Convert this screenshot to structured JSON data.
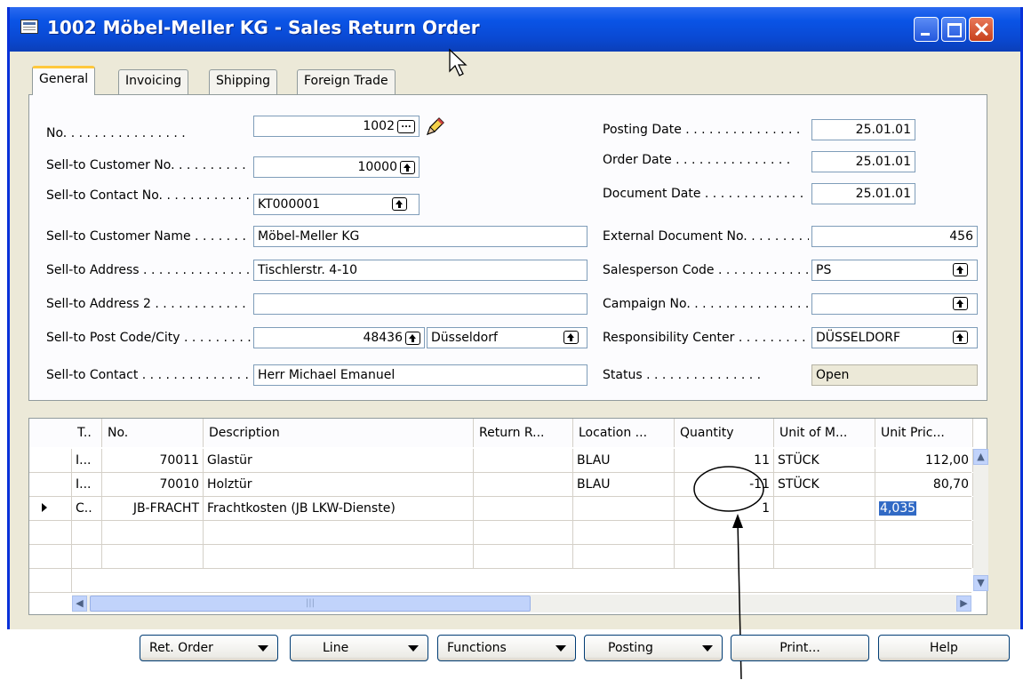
{
  "window": {
    "title": "1002 Möbel-Meller KG - Sales Return Order"
  },
  "tabs": [
    "General",
    "Invoicing",
    "Shipping",
    "Foreign Trade"
  ],
  "general": {
    "no": {
      "label": "No.",
      "value": "1002"
    },
    "sell_to_customer_no": {
      "label": "Sell-to Customer No.",
      "value": "10000"
    },
    "sell_to_contact_no": {
      "label": "Sell-to Contact No.",
      "value": "KT000001"
    },
    "sell_to_customer_name": {
      "label": "Sell-to Customer Name",
      "value": "Möbel-Meller KG"
    },
    "sell_to_address": {
      "label": "Sell-to Address",
      "value": "Tischlerstr. 4-10"
    },
    "sell_to_address_2": {
      "label": "Sell-to Address 2",
      "value": ""
    },
    "sell_to_post_code_city": {
      "label": "Sell-to Post Code/City",
      "post_code": "48436",
      "city": "Düsseldorf"
    },
    "sell_to_contact": {
      "label": "Sell-to Contact",
      "value": "Herr Michael Emanuel"
    },
    "posting_date": {
      "label": "Posting Date",
      "value": "25.01.01"
    },
    "order_date": {
      "label": "Order Date",
      "value": "25.01.01"
    },
    "document_date": {
      "label": "Document Date",
      "value": "25.01.01"
    },
    "external_document_no": {
      "label": "External Document No.",
      "value": "456"
    },
    "salesperson_code": {
      "label": "Salesperson Code",
      "value": "PS"
    },
    "campaign_no": {
      "label": "Campaign No.",
      "value": ""
    },
    "responsibility_center": {
      "label": "Responsibility Center",
      "value": "DÜSSELDORF"
    },
    "status": {
      "label": "Status",
      "value": "Open"
    }
  },
  "lines": {
    "columns": [
      "T..",
      "No.",
      "Description",
      "Return R...",
      "Location ...",
      "Quantity",
      "Unit of M...",
      "Unit Pric..."
    ],
    "rows": [
      {
        "type": "I...",
        "no": "70011",
        "description": "Glastür",
        "return_reason": "",
        "location": "BLAU",
        "quantity": "11",
        "uom": "STÜCK",
        "unit_price": "112,00"
      },
      {
        "type": "I...",
        "no": "70010",
        "description": "Holztür",
        "return_reason": "",
        "location": "BLAU",
        "quantity": "-11",
        "uom": "STÜCK",
        "unit_price": "80,70"
      },
      {
        "type": "C..",
        "no": "JB-FRACHT",
        "description": "Frachtkosten (JB LKW-Dienste)",
        "return_reason": "",
        "location": "",
        "quantity": "1",
        "uom": "",
        "unit_price": "4,035"
      }
    ]
  },
  "buttons": {
    "ret_order": "Ret. Order",
    "line": "Line",
    "functions": "Functions",
    "posting": "Posting",
    "print": "Print...",
    "help": "Help"
  }
}
